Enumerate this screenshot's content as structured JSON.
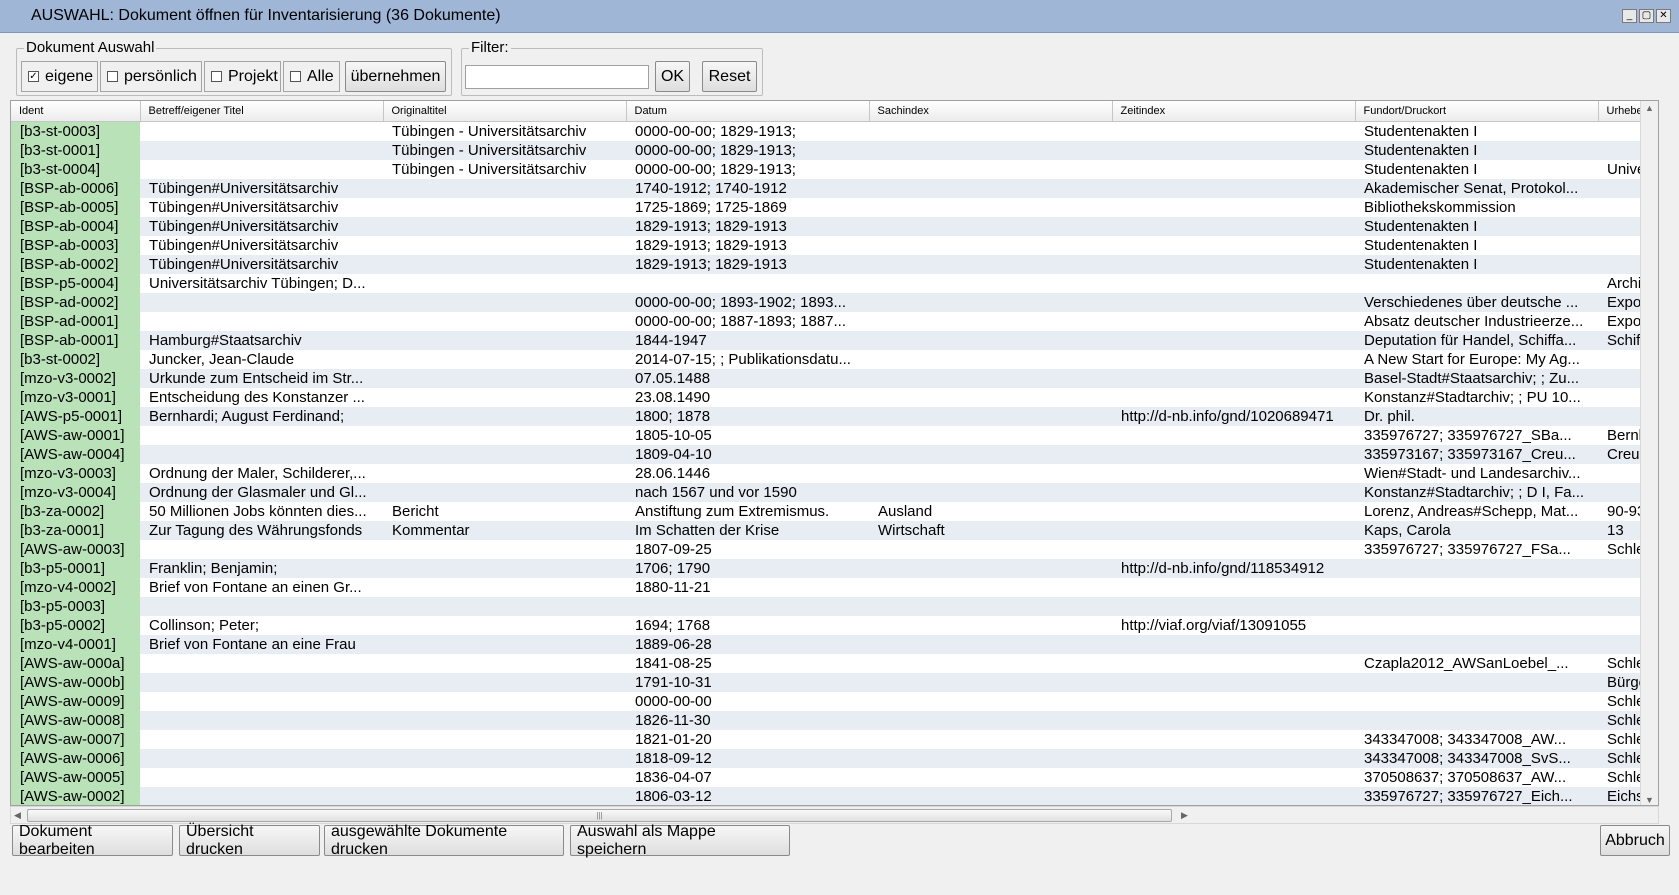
{
  "window": {
    "title": "AUSWAHL: Dokument öffnen für Inventarisierung (36 Dokumente)",
    "minimize_icon": "_",
    "maximize_icon": "▢",
    "close_icon": "✕"
  },
  "selection_group": {
    "legend": "Dokument Auswahl",
    "checkboxes": [
      {
        "label": "eigene",
        "checked": true
      },
      {
        "label": "persönlich",
        "checked": false
      },
      {
        "label": "Projekt",
        "checked": false
      },
      {
        "label": "Alle",
        "checked": false
      }
    ],
    "apply_label": "übernehmen"
  },
  "filter_group": {
    "legend": "Filter:",
    "input_value": "",
    "ok_label": "OK",
    "reset_label": "Reset"
  },
  "table": {
    "columns": [
      "Ident",
      "Betreff/eigener Titel",
      "Originaltitel",
      "Datum",
      "Sachindex",
      "Zeitindex",
      "Fundort/Druckort",
      "Urheber"
    ],
    "rows": [
      [
        "[b3-st-0003]",
        "",
        "Tübingen - Universitätsarchiv",
        "0000-00-00; 1829-1913;",
        "",
        "",
        "Studentenakten I",
        ""
      ],
      [
        "[b3-st-0001]",
        "",
        "Tübingen - Universitätsarchiv",
        "0000-00-00; 1829-1913;",
        "",
        "",
        "Studentenakten I",
        ""
      ],
      [
        "[b3-st-0004]",
        "",
        "Tübingen - Universitätsarchiv",
        "0000-00-00; 1829-1913;",
        "",
        "",
        "Studentenakten I",
        "Univer"
      ],
      [
        "[BSP-ab-0006]",
        "Tübingen#Universitätsarchiv",
        "",
        "1740-1912; 1740-1912",
        "",
        "",
        "Akademischer Senat, Protokol...",
        ""
      ],
      [
        "[BSP-ab-0005]",
        "Tübingen#Universitätsarchiv",
        "",
        "1725-1869; 1725-1869",
        "",
        "",
        "Bibliothekskommission",
        ""
      ],
      [
        "[BSP-ab-0004]",
        "Tübingen#Universitätsarchiv",
        "",
        "1829-1913; 1829-1913",
        "",
        "",
        "Studentenakten I",
        ""
      ],
      [
        "[BSP-ab-0003]",
        "Tübingen#Universitätsarchiv",
        "",
        "1829-1913; 1829-1913",
        "",
        "",
        "Studentenakten I",
        ""
      ],
      [
        "[BSP-ab-0002]",
        "Tübingen#Universitätsarchiv",
        "",
        "1829-1913; 1829-1913",
        "",
        "",
        "Studentenakten I",
        ""
      ],
      [
        "[BSP-p5-0004]",
        "Universitätsarchiv Tübingen; D...",
        "",
        "",
        "",
        "",
        "",
        "Archiv"
      ],
      [
        "[BSP-ad-0002]",
        "",
        "",
        "0000-00-00; 1893-1902; 1893...",
        "",
        "",
        "Verschiedenes über deutsche ...",
        "Expor"
      ],
      [
        "[BSP-ad-0001]",
        "",
        "",
        "0000-00-00; 1887-1893; 1887...",
        "",
        "",
        "Absatz deutscher Industrieerze...",
        "Expor"
      ],
      [
        "[BSP-ab-0001]",
        "Hamburg#Staatsarchiv",
        "",
        "1844-1947",
        "",
        "",
        "Deputation für Handel, Schiffa...",
        "Schifff"
      ],
      [
        "[b3-st-0002]",
        "Juncker, Jean-Claude",
        "",
        "2014-07-15; ; Publikationsdatu...",
        "",
        "",
        "A New Start for Europe: My Ag...",
        ""
      ],
      [
        "[mzo-v3-0002]",
        "Urkunde zum Entscheid im Str...",
        "",
        "07.05.1488",
        "",
        "",
        "Basel-Stadt#Staatsarchiv; ; Zu...",
        ""
      ],
      [
        "[mzo-v3-0001]",
        "Entscheidung des Konstanzer ...",
        "",
        "23.08.1490",
        "",
        "",
        "Konstanz#Stadtarchiv; ; PU 10...",
        ""
      ],
      [
        "[AWS-p5-0001]",
        "Bernhardi; August Ferdinand;",
        "",
        "1800; 1878",
        "",
        "http://d-nb.info/gnd/1020689471",
        "Dr. phil.",
        ""
      ],
      [
        "[AWS-aw-0001]",
        "",
        "",
        "1805-10-05",
        "",
        "",
        "335976727; 335976727_SBa...",
        "Bernh"
      ],
      [
        "[AWS-aw-0004]",
        "",
        "",
        "1809-04-10",
        "",
        "",
        "335973167; 335973167_Creu...",
        "Creuz"
      ],
      [
        "[mzo-v3-0003]",
        "Ordnung der Maler, Schilderer,...",
        "",
        "28.06.1446",
        "",
        "",
        "Wien#Stadt- und Landesarchiv...",
        ""
      ],
      [
        "[mzo-v3-0004]",
        "Ordnung der Glasmaler und Gl...",
        "",
        "nach 1567 und vor 1590",
        "",
        "",
        "Konstanz#Stadtarchiv; ; D I, Fa...",
        ""
      ],
      [
        "[b3-za-0002]",
        "50 Millionen Jobs könnten dies...",
        "Bericht",
        "Anstiftung zum Extremismus.",
        "Ausland",
        "",
        "Lorenz, Andreas#Schepp, Mat...",
        "90-93"
      ],
      [
        "[b3-za-0001]",
        "Zur Tagung des Währungsfonds",
        "Kommentar",
        "Im Schatten der Krise",
        "Wirtschaft",
        "",
        "Kaps, Carola",
        "13"
      ],
      [
        "[AWS-aw-0003]",
        "",
        "",
        "1807-09-25",
        "",
        "",
        "335976727; 335976727_FSa...",
        "Schleg"
      ],
      [
        "[b3-p5-0001]",
        "Franklin; Benjamin;",
        "",
        "1706; 1790",
        "",
        "http://d-nb.info/gnd/118534912",
        "",
        ""
      ],
      [
        "[mzo-v4-0002]",
        "Brief von Fontane an einen Gr...",
        "",
        "1880-11-21",
        "",
        "",
        "",
        ""
      ],
      [
        "[b3-p5-0003]",
        "",
        "",
        "",
        "",
        "",
        "",
        ""
      ],
      [
        "[b3-p5-0002]",
        "Collinson; Peter;",
        "",
        "1694; 1768",
        "",
        "http://viaf.org/viaf/13091055",
        "",
        ""
      ],
      [
        "[mzo-v4-0001]",
        "Brief von Fontane an eine Frau",
        "",
        "1889-06-28",
        "",
        "",
        "",
        ""
      ],
      [
        "[AWS-aw-000a]",
        "",
        "",
        "1841-08-25",
        "",
        "",
        "Czapla2012_AWSanLoebel_...",
        "Schleg"
      ],
      [
        "[AWS-aw-000b]",
        "",
        "",
        "1791-10-31",
        "",
        "",
        "",
        "Bürge"
      ],
      [
        "[AWS-aw-0009]",
        "",
        "",
        "0000-00-00",
        "",
        "",
        "",
        "Schleg"
      ],
      [
        "[AWS-aw-0008]",
        "",
        "",
        "1826-11-30",
        "",
        "",
        "",
        "Schleg"
      ],
      [
        "[AWS-aw-0007]",
        "",
        "",
        "1821-01-20",
        "",
        "",
        "343347008; 343347008_AW...",
        "Schleg"
      ],
      [
        "[AWS-aw-0006]",
        "",
        "",
        "1818-09-12",
        "",
        "",
        "343347008; 343347008_SvS...",
        "Schleg"
      ],
      [
        "[AWS-aw-0005]",
        "",
        "",
        "1836-04-07",
        "",
        "",
        "370508637; 370508637_AW...",
        "Schleg"
      ],
      [
        "[AWS-aw-0002]",
        "",
        "",
        "1806-03-12",
        "",
        "",
        "335976727; 335976727_Eich...",
        "Eichst"
      ]
    ]
  },
  "footer": {
    "edit_label": "Dokument bearbeiten",
    "print_overview_label": "Übersicht drucken",
    "print_selected_label": "ausgewählte Dokumente drucken",
    "save_folder_label": "Auswahl als Mappe speichern",
    "cancel_label": "Abbruch"
  }
}
